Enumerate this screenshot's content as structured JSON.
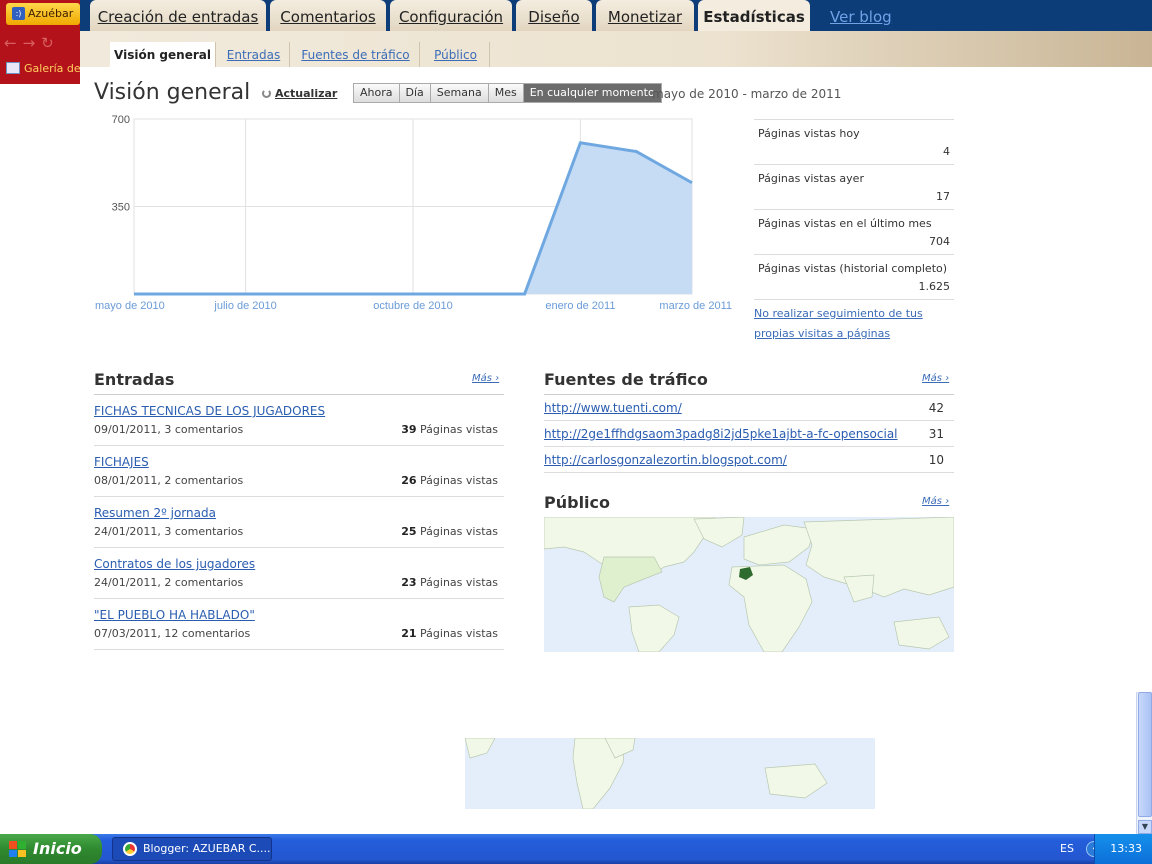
{
  "browser_strip": {
    "profile_label": "Azuébar",
    "bookmark_label": "Galería de"
  },
  "top_tabs": [
    {
      "label": "Creación de entradas"
    },
    {
      "label": "Comentarios"
    },
    {
      "label": "Configuración"
    },
    {
      "label": "Diseño"
    },
    {
      "label": "Monetizar"
    },
    {
      "label": "Estadísticas",
      "active": true
    }
  ],
  "view_blog_label": "Ver blog",
  "sub_tabs": [
    {
      "label": "Visión general",
      "active": true
    },
    {
      "label": "Entradas"
    },
    {
      "label": "Fuentes de tráfico"
    },
    {
      "label": "Público"
    }
  ],
  "overview": {
    "title": "Visión general",
    "refresh_label": "Actualizar",
    "ranges": [
      "Ahora",
      "Día",
      "Semana",
      "Mes",
      "En cualquier momento"
    ],
    "selected_range": "En cualquier momento",
    "date_range": "mayo de 2010 - marzo de 2011"
  },
  "chart_data": {
    "type": "area",
    "x": [
      "mayo de 2010",
      "junio de 2010",
      "julio de 2010",
      "agosto de 2010",
      "septiembre de 2010",
      "octubre de 2010",
      "noviembre de 2010",
      "diciembre de 2010",
      "enero de 2011",
      "febrero de 2011",
      "marzo de 2011"
    ],
    "values": [
      0,
      0,
      0,
      0,
      0,
      0,
      0,
      0,
      605,
      570,
      445
    ],
    "xticks": [
      "mayo de 2010",
      "julio de 2010",
      "octubre de 2010",
      "enero de 2011",
      "marzo de 2011"
    ],
    "yticks": [
      "700",
      "350"
    ],
    "ylim": [
      0,
      700
    ],
    "grid": true,
    "line_color": "#6fa8e0",
    "fill_color": "#c6dbf4"
  },
  "stats": [
    {
      "label": "Páginas vistas hoy",
      "value": "4"
    },
    {
      "label": "Páginas vistas ayer",
      "value": "17"
    },
    {
      "label": "Páginas vistas en el último mes",
      "value": "704"
    },
    {
      "label": "Páginas vistas (historial completo)",
      "value": "1.625"
    }
  ],
  "no_track_link": "No realizar seguimiento de tus propias visitas a páginas",
  "entries_section": {
    "title": "Entradas",
    "more": "Más ›",
    "views_suffix": "Páginas vistas",
    "items": [
      {
        "title": "FICHAS TECNICAS DE LOS JUGADORES",
        "meta": "09/01/2011, 3 comentarios",
        "views": "39"
      },
      {
        "title": "FICHAJES",
        "meta": "08/01/2011, 2 comentarios",
        "views": "26"
      },
      {
        "title": "Resumen 2º jornada",
        "meta": "24/01/2011, 3 comentarios",
        "views": "25"
      },
      {
        "title": "Contratos de los jugadores",
        "meta": "24/01/2011, 2 comentarios",
        "views": "23"
      },
      {
        "title": "\"EL PUEBLO HA HABLADO\"",
        "meta": "07/03/2011, 12 comentarios",
        "views": "21"
      }
    ]
  },
  "sources_section": {
    "title": "Fuentes de tráfico",
    "more": "Más ›",
    "items": [
      {
        "url": "http://www.tuenti.com/",
        "count": "42"
      },
      {
        "url": "http://2ge1ffhdgsaom3padg8i2jd5pke1ajbt-a-fc-opensocial",
        "count": "31"
      },
      {
        "url": "http://carlosgonzalezortin.blogspot.com/",
        "count": "10"
      }
    ]
  },
  "audience_section": {
    "title": "Público",
    "more": "Más ›"
  },
  "taskbar": {
    "start_label": "Inicio",
    "task_label": "Blogger: AZUEBAR C....",
    "lang": "ES",
    "clock": "13:33"
  }
}
